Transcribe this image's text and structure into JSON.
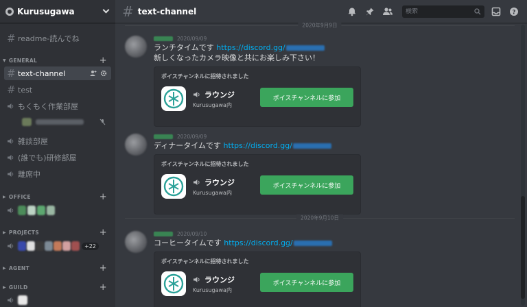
{
  "guild": {
    "name": "Kurusugawa"
  },
  "sidebar": {
    "channels_top": [
      {
        "label": "readme-読んでね",
        "type": "text"
      }
    ],
    "categories": [
      {
        "label": "GENERAL"
      },
      {
        "label": "OFFICE"
      },
      {
        "label": "PROJECTS"
      },
      {
        "label": "AGENT"
      },
      {
        "label": "GUILD"
      }
    ],
    "general_channels": [
      {
        "label": "text-channel",
        "type": "text",
        "active": true
      },
      {
        "label": "test",
        "type": "text"
      },
      {
        "label": "もくもく作業部屋",
        "type": "voice"
      },
      {
        "label": "雑談部屋",
        "type": "voice"
      },
      {
        "label": "(誰でも)研修部屋",
        "type": "voice"
      },
      {
        "label": "離席中",
        "type": "voice"
      }
    ],
    "projects_more": "+22"
  },
  "topbar": {
    "channel_name": "text-channel",
    "search_placeholder": "検索",
    "icons": [
      "bell-icon",
      "pin-icon",
      "members-icon",
      "inbox-icon",
      "help-icon"
    ]
  },
  "messages": {
    "dividers": [
      "2020年9月9日",
      "2020年9月10日"
    ],
    "items": [
      {
        "timestamp": "2020/09/09",
        "line1_text": "ランチタイムです ",
        "link": "https://discord.gg/",
        "line2": "新しくなったカメラ映像と共にお楽しみ下さい！"
      },
      {
        "timestamp": "2020/09/09",
        "line1_text": "ディナータイムです ",
        "link": "https://discord.gg/",
        "line2": ""
      },
      {
        "timestamp": "2020/09/10",
        "line1_text": "コーヒータイムです ",
        "link": "https://discord.gg/",
        "line2": ""
      }
    ],
    "invite": {
      "title": "ボイスチャンネルに招待されました",
      "voice_channel": "ラウンジ",
      "guild_label": "Kurusugawa内",
      "join_label": "ボイスチャンネルに参加"
    }
  },
  "colors": {
    "accent_green": "#3ba55c",
    "link_blue": "#00b0f4",
    "sidebar_bg": "#2f3136",
    "chat_bg": "#36393f"
  }
}
